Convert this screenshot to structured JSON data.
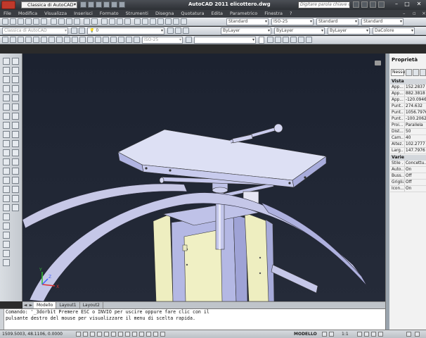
{
  "titlebar": {
    "workspace": "Classica di AutoCAD",
    "title": "AutoCAD 2011     elicottero.dwg",
    "help_placeholder": "Digitare parola chiave o frase"
  },
  "menu": [
    "File",
    "Modifica",
    "Visualizza",
    "Inserisci",
    "Formato",
    "Strumenti",
    "Disegna",
    "Quotatura",
    "Edita",
    "Parametrico",
    "Finestra",
    "?"
  ],
  "toolbars": {
    "row1": {
      "style1": "Standard",
      "style2": "ISO-25",
      "style3": "Standard",
      "style4": "Standard"
    },
    "row2": {
      "workspace": "Classica di AutoCAD",
      "layer": "0",
      "color": "ByLayer",
      "linetype": "ByLayer",
      "lineweight": "ByLayer",
      "plot": "DaColore"
    },
    "row3": {
      "dimstyle": "ISO-25"
    }
  },
  "tabs": {
    "nav": [
      "◄",
      "►"
    ],
    "items": [
      "Modello",
      "Layout1",
      "Layout2"
    ]
  },
  "command": {
    "line1": "Comando: '_3dorbit Premere ESC o INVIO per uscire oppure fare clic con il",
    "line2": "pulsante destro del mouse per visualizzare il menu di scelta rapida."
  },
  "status": {
    "coords": "1509.5003, 48.1106, 0.0000",
    "space": "MODELLO",
    "scale": "1:1"
  },
  "properties": {
    "title": "Proprietà",
    "selection": "Nessu",
    "section_view": "Vista",
    "view_rows": [
      {
        "k": "App...",
        "v": "152.2837"
      },
      {
        "k": "App...",
        "v": "882.3818"
      },
      {
        "k": "App...",
        "v": "-120.0946"
      },
      {
        "k": "Punt...",
        "v": "274.632"
      },
      {
        "k": "Punt...",
        "v": "1056.7976"
      },
      {
        "k": "Punt...",
        "v": "-100.2062"
      },
      {
        "k": "Proi...",
        "v": "Parallela"
      },
      {
        "k": "Dist...",
        "v": "50"
      },
      {
        "k": "Cam...",
        "v": "40"
      },
      {
        "k": "Altez...",
        "v": "102.2777"
      },
      {
        "k": "Larg...",
        "v": "147.7976"
      }
    ],
    "section_misc": "Varie",
    "misc_rows": [
      {
        "k": "Stile ...",
        "v": "Concettu..."
      },
      {
        "k": "Auto...",
        "v": "On"
      },
      {
        "k": "Buss...",
        "v": "Off"
      },
      {
        "k": "Griglia",
        "v": "Off"
      },
      {
        "k": "Icon...",
        "v": "On"
      }
    ]
  },
  "ucs": {
    "x": "X",
    "y": "Y",
    "z": "Z"
  }
}
